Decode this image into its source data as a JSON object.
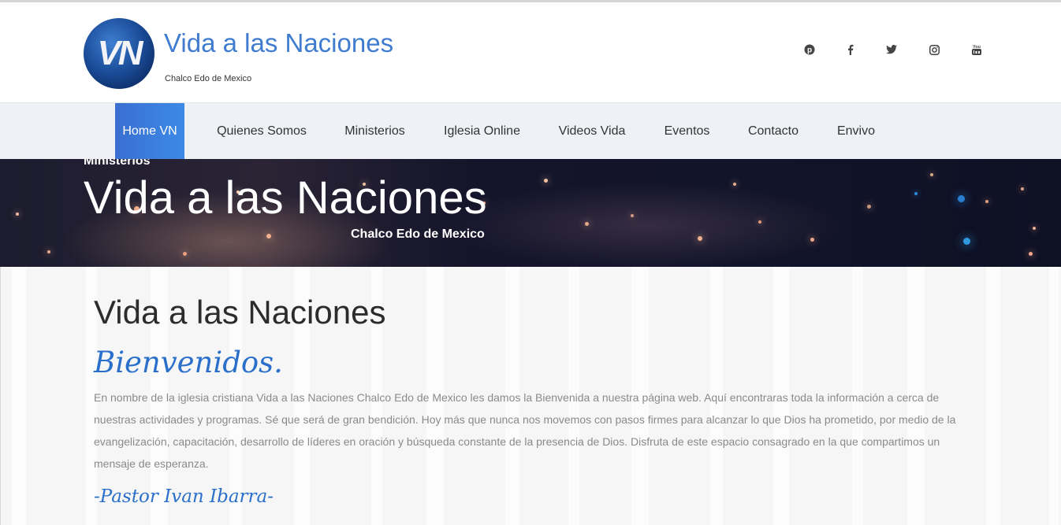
{
  "header": {
    "logo_text": "VN",
    "title": "Vida a las Naciones",
    "subtitle": "Chalco Edo de Mexico",
    "social": [
      {
        "name": "pinterest-icon",
        "glyph": "℗"
      },
      {
        "name": "facebook-icon",
        "glyph": "f"
      },
      {
        "name": "twitter-icon",
        "glyph": "🐦"
      },
      {
        "name": "instagram-icon",
        "glyph": "◎"
      },
      {
        "name": "youtube-icon",
        "glyph": "▶"
      }
    ]
  },
  "nav": {
    "items": [
      {
        "label": "Home VN",
        "active": true
      },
      {
        "label": "Quienes Somos"
      },
      {
        "label": "Ministerios"
      },
      {
        "label": "Iglesia Online"
      },
      {
        "label": "Videos Vida"
      },
      {
        "label": "Eventos"
      },
      {
        "label": "Contacto"
      },
      {
        "label": "Envivo"
      }
    ]
  },
  "banner": {
    "small": "Ministerios",
    "title": "Vida a las Naciones",
    "subtitle": "Chalco Edo de Mexico"
  },
  "content": {
    "title": "Vida a las Naciones",
    "welcome": "Bienvenidos.",
    "paragraph": "En nombre de la iglesia cristiana Vida a las Naciones Chalco Edo de Mexico les damos la Bienvenida a nuestra página web. Aquí encontraras toda la información a cerca de nuestras actividades y programas. Sé que será de gran bendición. Hoy más que nunca nos movemos con pasos firmes para alcanzar lo que Dios ha prometido, por medio de la evangelización, capacitación, desarrollo de líderes en oración y búsqueda constante de la presencia de Dios. Disfruta de este espacio consagrado en la que compartimos un mensaje de esperanza.",
    "signature": "-Pastor Ivan Ibarra-"
  },
  "colors": {
    "accent": "#3f7ccf",
    "nav_active": "#3a7ee0",
    "welcome": "#2a6fc9"
  }
}
